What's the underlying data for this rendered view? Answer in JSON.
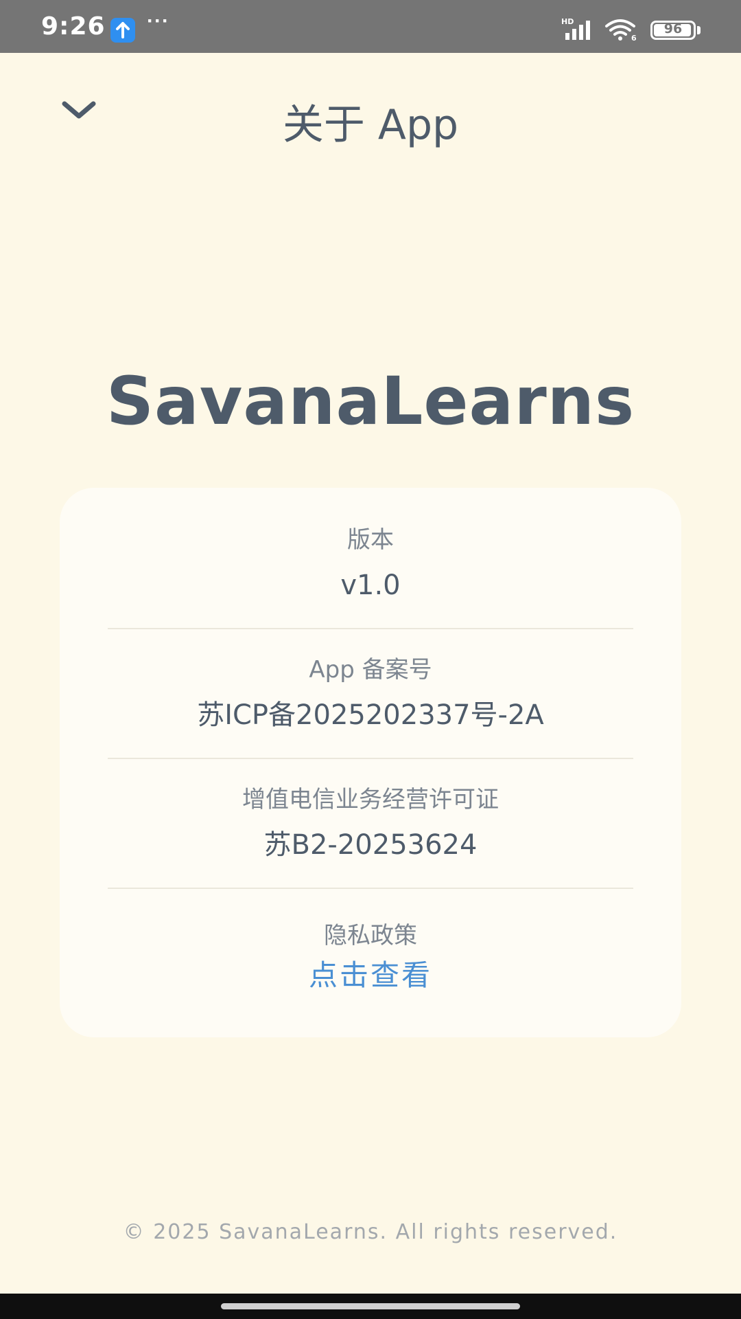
{
  "status_bar": {
    "time": "9:26",
    "dots": "···",
    "battery_level": "96",
    "icons": [
      "upload-icon",
      "signal-icon",
      "wifi-icon",
      "battery-icon"
    ]
  },
  "header": {
    "title": "关于 App",
    "back_icon": "chevron-down-icon"
  },
  "app": {
    "name": "SavanaLearns"
  },
  "info": {
    "version_label": "版本",
    "version_value": "v1.0",
    "icp_label": "App 备案号",
    "icp_value": "苏ICP备2025202337号-2A",
    "license_label": "增值电信业务经营许可证",
    "license_value": "苏B2-20253624",
    "privacy_label": "隐私政策",
    "privacy_link": "点击查看"
  },
  "footer": {
    "copyright": "© 2025 SavanaLearns. All rights reserved."
  },
  "colors": {
    "background": "#fdf8e7",
    "card": "#fefcf5",
    "text": "#4e5b6a",
    "label": "#7c8590",
    "link": "#4a8fd3",
    "status_bar": "#757575"
  }
}
